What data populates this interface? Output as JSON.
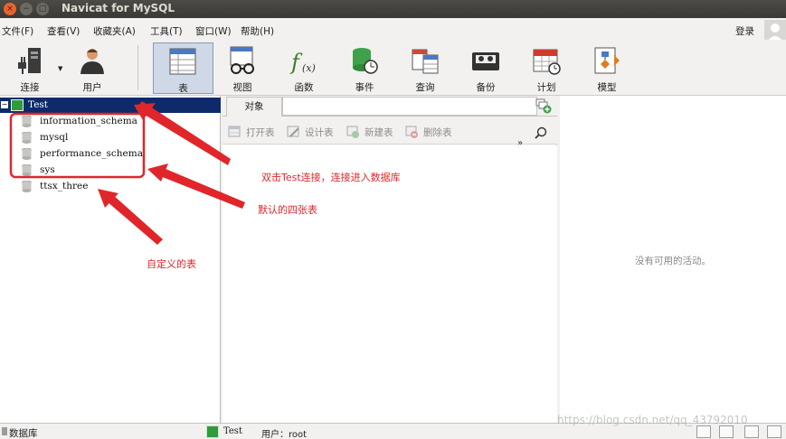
{
  "window": {
    "title": "Navicat for MySQL",
    "controls": {
      "close": "×",
      "minimize": "−",
      "maximize": "□"
    }
  },
  "menu": {
    "items": [
      "文件(F)",
      "查看(V)",
      "收藏夹(A)",
      "工具(T)",
      "窗口(W)",
      "帮助(H)"
    ],
    "login": "登录"
  },
  "toolbar": {
    "items": [
      {
        "label": "连接",
        "icon": "plug-icon"
      },
      {
        "label": "用户",
        "icon": "user-icon"
      },
      {
        "label": "表",
        "icon": "table-icon",
        "active": true
      },
      {
        "label": "视图",
        "icon": "view-icon"
      },
      {
        "label": "函数",
        "icon": "function-icon"
      },
      {
        "label": "事件",
        "icon": "event-icon"
      },
      {
        "label": "查询",
        "icon": "query-icon"
      },
      {
        "label": "备份",
        "icon": "backup-icon"
      },
      {
        "label": "计划",
        "icon": "schedule-icon"
      },
      {
        "label": "模型",
        "icon": "model-icon"
      }
    ],
    "dropdown_glyph": "▼"
  },
  "tree": {
    "connection": "Test",
    "expander": "−",
    "databases": [
      "information_schema",
      "mysql",
      "performance_schema",
      "sys",
      "ttsx_three"
    ]
  },
  "objects": {
    "tab": "对象",
    "actions": [
      "打开表",
      "设计表",
      "新建表",
      "删除表"
    ],
    "more": "»",
    "more_arrow": "▾"
  },
  "info": {
    "empty_message": "没有可用的活动。"
  },
  "status": {
    "left": "数据库",
    "connection": "Test",
    "user": "用户：root"
  },
  "watermark": "https://blog.csdn.net/qq_43792010",
  "annotations": {
    "connect_note": "双击Test连接，连接进入数据库",
    "default_tables_note": "默认的四张表",
    "custom_table_note": "自定义的表",
    "color": "#e0262a"
  },
  "colors": {
    "selection": "#0d2b6b",
    "connection_green": "#2e9b3d",
    "annotation_red": "#e0262a"
  }
}
